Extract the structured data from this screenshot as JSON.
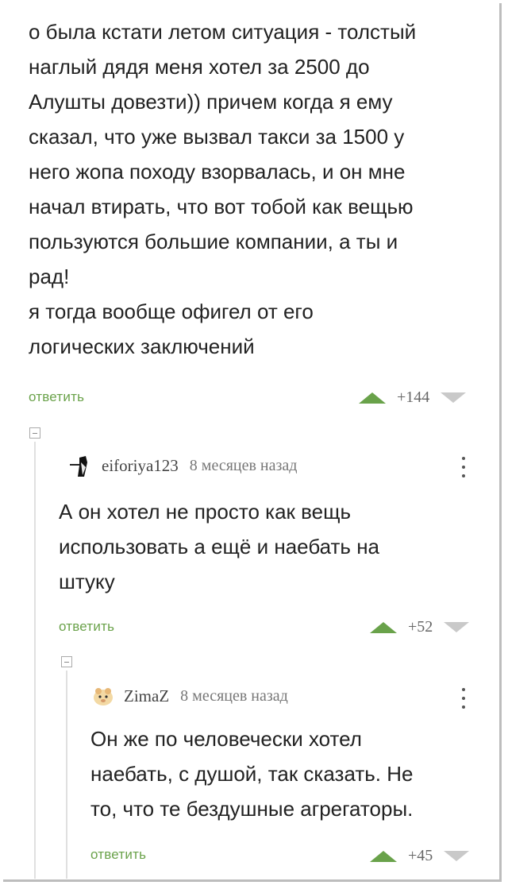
{
  "comments": [
    {
      "text_lines": [
        "о была кстати летом ситуация - толстый",
        "наглый дядя меня хотел за 2500 до",
        "Алушты довезти)) причем когда я ему",
        "сказал, что уже вызвал такси за 1500 у",
        "него жопа походу взорвалась, и он мне",
        "начал втирать, что вот тобой как вещью",
        "пользуются большие компании, а ты и",
        "рад!",
        "я тогда вообще офигел от его",
        "логических заключений"
      ],
      "reply_label": "ответить",
      "score": "+144"
    },
    {
      "username": "eiforiya123",
      "timestamp": "8 месяцев назад",
      "text_lines": [
        "А он хотел не просто как вещь",
        "использовать а ещё и наебать на",
        "штуку"
      ],
      "reply_label": "ответить",
      "score": "+52"
    },
    {
      "username": "ZimaZ",
      "timestamp": "8 месяцев назад",
      "text_lines": [
        "Он же по человечески хотел",
        "наебать, с душой, так сказать. Не",
        "то, что те бездушные агрегаторы."
      ],
      "reply_label": "ответить",
      "score": "+45"
    }
  ],
  "colors": {
    "reply_link": "#6aa24a",
    "upvote": "#69a24a",
    "downvote": "#c9c9c9"
  }
}
